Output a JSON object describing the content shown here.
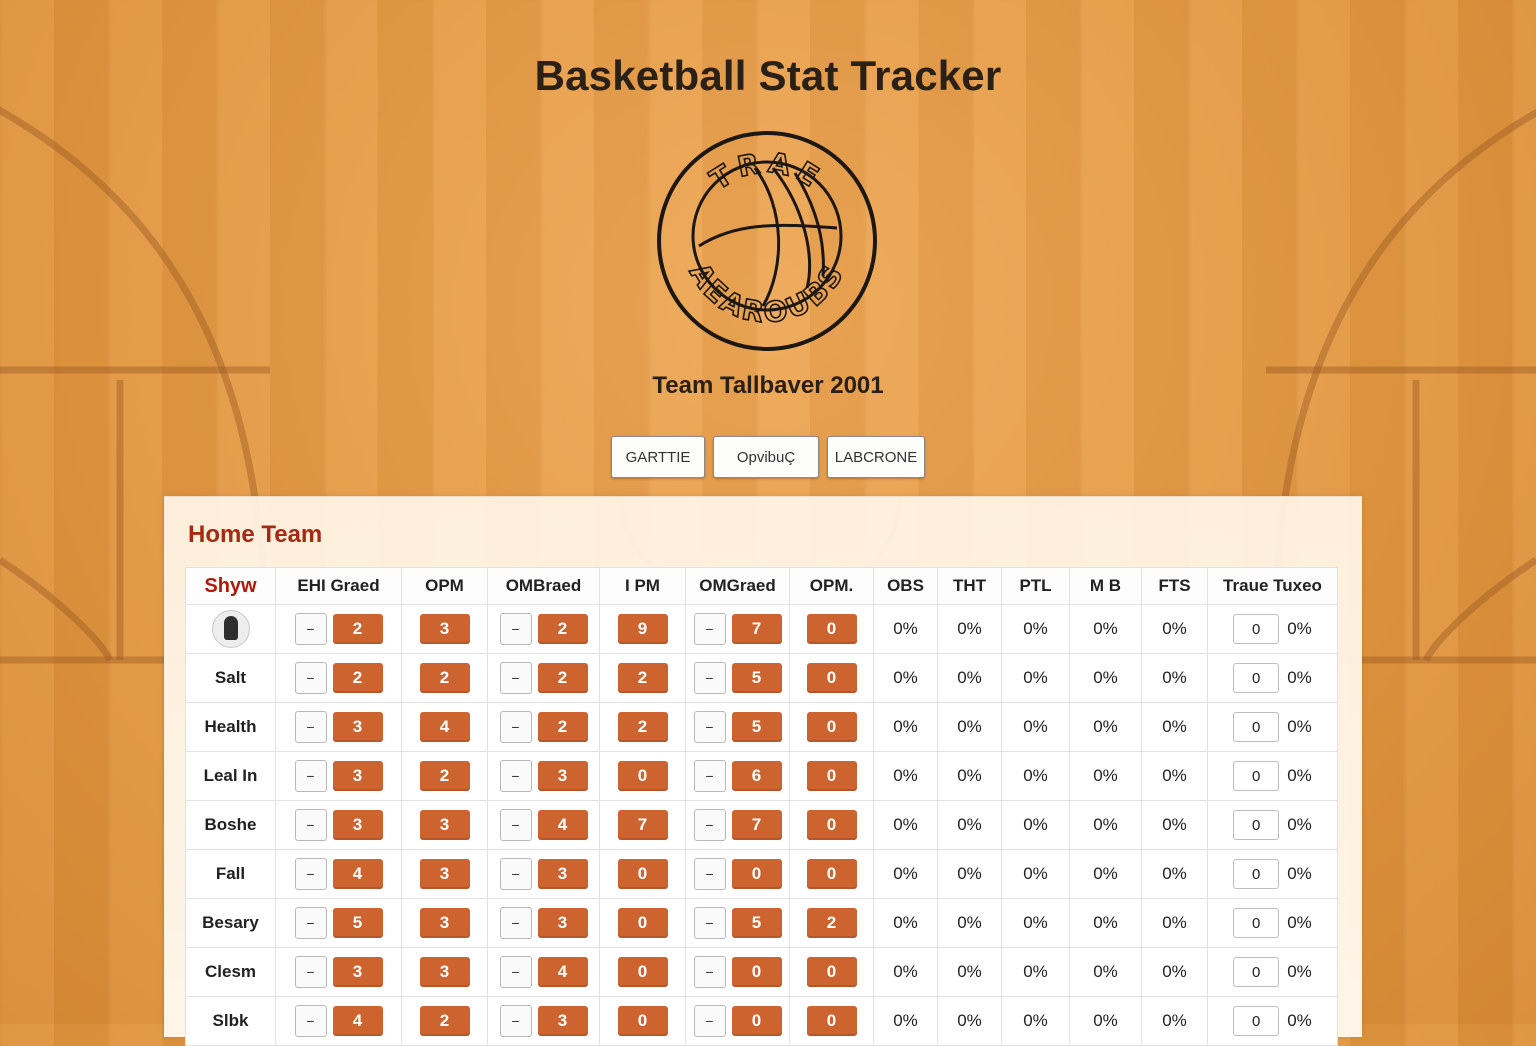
{
  "app": {
    "title": "Basketball Stat Tracker",
    "logo_top_text": "TRAE",
    "logo_bottom_text": "AEAROUBS",
    "subtitle": "Team Tallbaver 2001"
  },
  "tabs": [
    {
      "label": "GARTTIE"
    },
    {
      "label": "OpvibuÇ"
    },
    {
      "label": "LABCRONE"
    }
  ],
  "team_panel": {
    "title": "Home Team",
    "columns": [
      "Shyw",
      "EHI Graed",
      "OPM",
      "OMBraed",
      "I PM",
      "OMGraed",
      "OPM.",
      "OBS",
      "THT",
      "PTL",
      "M B",
      "FTS",
      "Traue Tuxeo"
    ],
    "minus_symbol": "−",
    "rows": [
      {
        "name": "",
        "avatar": true,
        "v1": "2",
        "v2": "3",
        "v3": "2",
        "v4": "9",
        "v5": "7",
        "v6": "0",
        "p1": "0%",
        "p2": "0%",
        "p3": "0%",
        "p4": "0%",
        "p5": "0%",
        "input": "0",
        "p6": "0%"
      },
      {
        "name": "Salt",
        "v1": "2",
        "v2": "2",
        "v3": "2",
        "v4": "2",
        "v5": "5",
        "v6": "0",
        "p1": "0%",
        "p2": "0%",
        "p3": "0%",
        "p4": "0%",
        "p5": "0%",
        "input": "0",
        "p6": "0%"
      },
      {
        "name": "Health",
        "v1": "3",
        "v2": "4",
        "v3": "2",
        "v4": "2",
        "v5": "5",
        "v6": "0",
        "p1": "0%",
        "p2": "0%",
        "p3": "0%",
        "p4": "0%",
        "p5": "0%",
        "input": "0",
        "p6": "0%"
      },
      {
        "name": "Leal In",
        "v1": "3",
        "v2": "2",
        "v3": "3",
        "v4": "0",
        "v5": "6",
        "v6": "0",
        "p1": "0%",
        "p2": "0%",
        "p3": "0%",
        "p4": "0%",
        "p5": "0%",
        "input": "0",
        "p6": "0%"
      },
      {
        "name": "Boshe",
        "v1": "3",
        "v2": "3",
        "v3": "4",
        "v4": "7",
        "v5": "7",
        "v6": "0",
        "p1": "0%",
        "p2": "0%",
        "p3": "0%",
        "p4": "0%",
        "p5": "0%",
        "input": "0",
        "p6": "0%"
      },
      {
        "name": "Fall",
        "v1": "4",
        "v2": "3",
        "v3": "3",
        "v4": "0",
        "v5": "0",
        "v6": "0",
        "p1": "0%",
        "p2": "0%",
        "p3": "0%",
        "p4": "0%",
        "p5": "0%",
        "input": "0",
        "p6": "0%"
      },
      {
        "name": "Besary",
        "v1": "5",
        "v2": "3",
        "v3": "3",
        "v4": "0",
        "v5": "5",
        "v6": "2",
        "p1": "0%",
        "p2": "0%",
        "p3": "0%",
        "p4": "0%",
        "p5": "0%",
        "input": "0",
        "p6": "0%"
      },
      {
        "name": "Clesm",
        "v1": "3",
        "v2": "3",
        "v3": "4",
        "v4": "0",
        "v5": "0",
        "v6": "0",
        "p1": "0%",
        "p2": "0%",
        "p3": "0%",
        "p4": "0%",
        "p5": "0%",
        "input": "0",
        "p6": "0%"
      },
      {
        "name": "Slbk",
        "v1": "4",
        "v2": "2",
        "v3": "3",
        "v4": "0",
        "v5": "0",
        "v6": "0",
        "p1": "0%",
        "p2": "0%",
        "p3": "0%",
        "p4": "0%",
        "p5": "0%",
        "input": "0",
        "p6": "0%"
      }
    ]
  }
}
